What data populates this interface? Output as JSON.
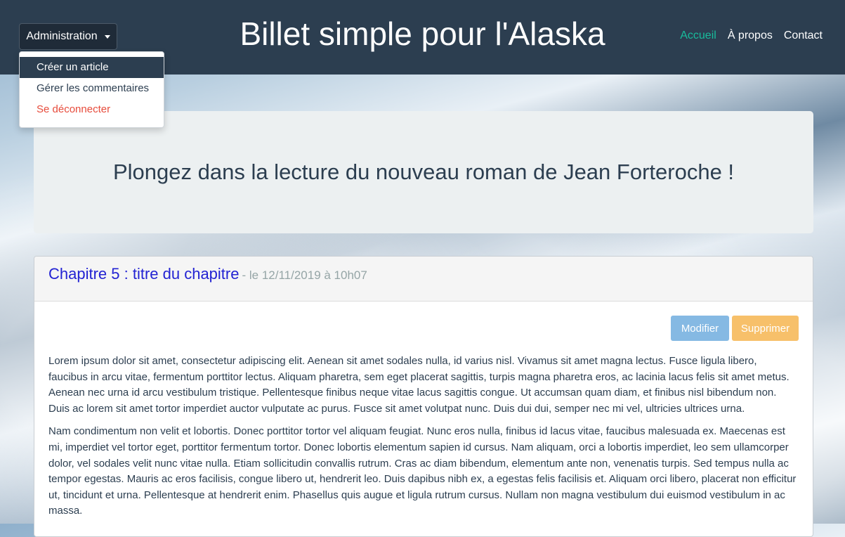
{
  "header": {
    "title": "Billet simple pour l'Alaska",
    "admin_label": "Administration",
    "nav": [
      {
        "label": "Accueil",
        "active": true
      },
      {
        "label": "À propos",
        "active": false
      },
      {
        "label": "Contact",
        "active": false
      }
    ]
  },
  "admin_menu": {
    "items": [
      {
        "label": "Créer un article"
      },
      {
        "label": "Gérer les commentaires"
      },
      {
        "label": "Se déconnecter"
      }
    ]
  },
  "jumbotron": {
    "text": "Plongez dans la lecture du nouveau roman de Jean Forteroche !"
  },
  "post": {
    "title": "Chapitre 5 : titre du chapitre",
    "meta": "- le 12/11/2019 à 10h07",
    "edit_label": "Modifier",
    "delete_label": "Supprimer",
    "paragraphs": [
      "Lorem ipsum dolor sit amet, consectetur adipiscing elit. Aenean sit amet sodales nulla, id varius nisl. Vivamus sit amet magna lectus. Fusce ligula libero, faucibus in arcu vitae, fermentum porttitor lectus. Aliquam pharetra, sem eget placerat sagittis, turpis magna pharetra eros, ac lacinia lacus felis sit amet metus. Aenean nec urna id arcu vestibulum tristique. Pellentesque finibus neque vitae lacus sagittis congue. Ut accumsan quam diam, et finibus nisl bibendum non. Duis ac lorem sit amet tortor imperdiet auctor vulputate ac purus. Fusce sit amet volutpat nunc. Duis dui dui, semper nec mi vel, ultricies ultrices urna.",
      "Nam condimentum non velit et lobortis. Donec porttitor tortor vel aliquam feugiat. Nunc eros nulla, finibus id lacus vitae, faucibus malesuada ex. Maecenas est mi, imperdiet vel tortor eget, porttitor fermentum tortor. Donec lobortis elementum sapien id cursus. Nam aliquam, orci a lobortis imperdiet, leo sem ullamcorper dolor, vel sodales velit nunc vitae nulla. Etiam sollicitudin convallis rutrum. Cras ac diam bibendum, elementum ante non, venenatis turpis. Sed tempus nulla ac tempor egestas. Mauris ac eros facilisis, congue libero ut, hendrerit leo. Duis dapibus nibh ex, a egestas felis facilisis et. Aliquam orci libero, placerat non efficitur ut, tincidunt et urna. Pellentesque at hendrerit enim. Phasellus quis augue et ligula rutrum cursus. Nullam non magna vestibulum dui euismod vestibulum in ac massa."
    ]
  },
  "colors": {
    "navbar": "#2c3e50",
    "nav_active": "#18bc9c",
    "danger": "#e74c3c",
    "title_link": "#2323d3",
    "btn_edit": "#85b9e3",
    "btn_delete": "#f7c06a"
  }
}
